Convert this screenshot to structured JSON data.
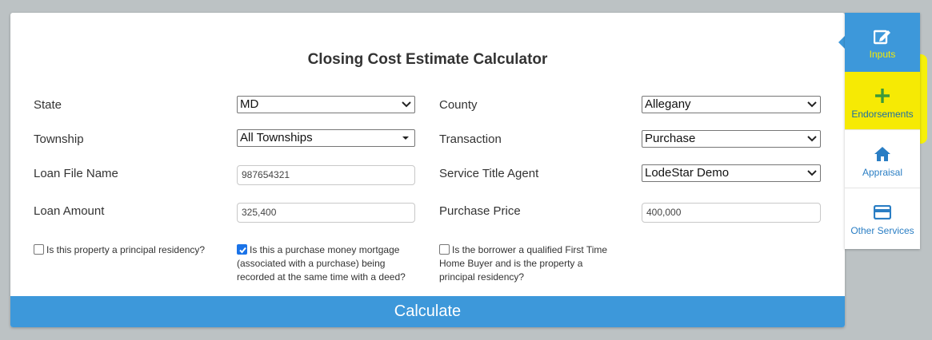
{
  "title": "Closing Cost Estimate Calculator",
  "fields": {
    "state": {
      "label": "State",
      "value": "MD"
    },
    "county": {
      "label": "County",
      "value": "Allegany"
    },
    "township": {
      "label": "Township",
      "value": "All Townships"
    },
    "transaction": {
      "label": "Transaction",
      "value": "Purchase"
    },
    "loan_file_name": {
      "label": "Loan File Name",
      "value": "987654321"
    },
    "service_title_agent": {
      "label": "Service Title Agent",
      "value": "LodeStar Demo"
    },
    "loan_amount": {
      "label": "Loan Amount",
      "value": "325,400"
    },
    "purchase_price": {
      "label": "Purchase Price",
      "value": "400,000"
    }
  },
  "checkboxes": {
    "principal_residency": {
      "label": "Is this property a principal residency?",
      "checked": false
    },
    "purchase_money_mortgage": {
      "label_line1": "Is this a purchase money mortgage",
      "label_line2": "(associated with a purchase) being",
      "label_line3": "recorded at the same time with a deed?",
      "checked": true
    },
    "first_time_buyer": {
      "label_line1": "Is the borrower a qualified First Time",
      "label_line2": "Home Buyer and is the property a",
      "label_line3": "principal residency?",
      "checked": false
    }
  },
  "calculate_label": "Calculate",
  "sidebar": {
    "items": [
      {
        "label": "Inputs",
        "icon": "edit-icon"
      },
      {
        "label": "Endorsements",
        "icon": "plus-icon"
      },
      {
        "label": "Appraisal",
        "icon": "home-icon"
      },
      {
        "label": "Other Services",
        "icon": "credit-card-icon"
      }
    ]
  },
  "colors": {
    "accent": "#3d98da",
    "highlight": "#f9f200",
    "checkbox": "#1a73e8"
  }
}
